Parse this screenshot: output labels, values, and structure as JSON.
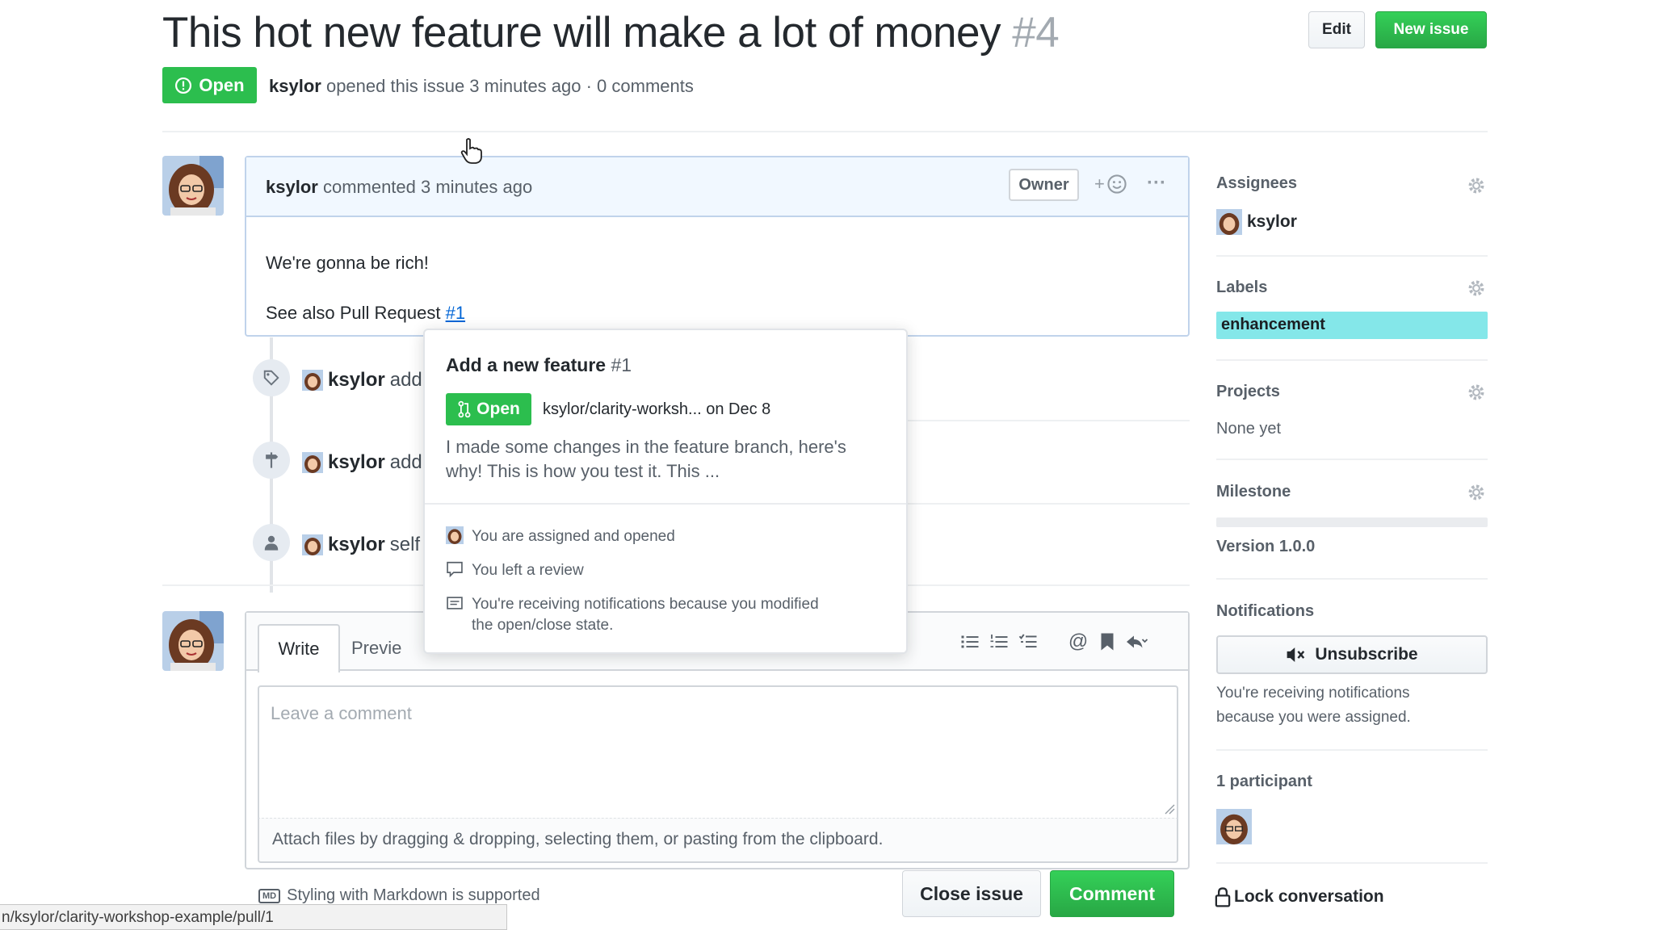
{
  "header": {
    "title": "This hot new feature will make a lot of money",
    "number": "#4",
    "edit_label": "Edit",
    "new_issue_label": "New issue",
    "state": "Open",
    "author": "ksylor",
    "meta_text": "opened this issue 3 minutes ago · 0 comments"
  },
  "comment": {
    "author": "ksylor",
    "meta": "commented 3 minutes ago",
    "owner_tag": "Owner",
    "reaction_label": "+",
    "more_label": "···",
    "body_line1": "We're gonna be rich!",
    "body_line2_prefix": "See also Pull Request",
    "body_link": "#1"
  },
  "timeline": [
    {
      "user": "ksylor",
      "text": "add"
    },
    {
      "user": "ksylor",
      "text": "add"
    },
    {
      "user": "ksylor",
      "text": "self"
    }
  ],
  "editor": {
    "tab_write": "Write",
    "tab_preview": "Previe",
    "placeholder": "Leave a comment",
    "attach_text": "Attach files by dragging & dropping, selecting them, or pasting from the clipboard.",
    "markdown_badge": "MD",
    "markdown_note": "Styling with Markdown is supported",
    "close_issue": "Close issue",
    "comment_button": "Comment"
  },
  "popover": {
    "title": "Add a new feature",
    "number": "#1",
    "state": "Open",
    "repo": "ksylor/clarity-worksh... on Dec 8",
    "description": "I made some changes in the feature branch, here's why! This is how you test it. This ...",
    "reason1": "You are assigned and opened",
    "reason2": "You left a review",
    "reason3_line1": "You're receiving notifications because you modified",
    "reason3_line2": "the open/close state."
  },
  "sidebar": {
    "assignees_heading": "Assignees",
    "assignee": "ksylor",
    "labels_heading": "Labels",
    "label": "enhancement",
    "label_color": "#84e7e9",
    "projects_heading": "Projects",
    "projects_value": "None yet",
    "milestone_heading": "Milestone",
    "milestone_value": "Version 1.0.0",
    "notifications_heading": "Notifications",
    "unsubscribe_label": "Unsubscribe",
    "notifications_line1": "You're receiving notifications",
    "notifications_line2": "because you were assigned.",
    "participants_heading": "1 participant",
    "lock_label": "Lock conversation"
  },
  "status_bar_url": "n/ksylor/clarity-workshop-example/pull/1",
  "colors": {
    "open_green": "#2cbe4e",
    "link_blue": "#0366d6",
    "comment_header_bg": "#f1f8ff"
  }
}
